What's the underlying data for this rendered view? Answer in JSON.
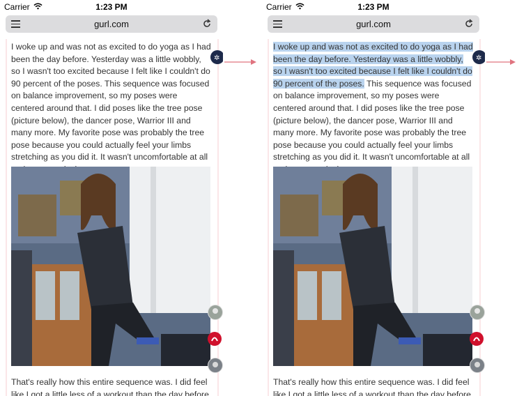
{
  "screens": [
    {
      "status": {
        "carrier": "Carrier",
        "time": "1:23 PM"
      },
      "browser": {
        "url": "gurl.com"
      },
      "article": {
        "paragraph1_highlighted": "",
        "paragraph1": "I woke up and was not as excited to do yoga as I had been the day before. Yesterday was a little wobbly, so I wasn't too excited because I felt like I couldn't do 90 percent of the poses. This sequence was focused on balance improvement, so my poses were centered around that. I did poses like the tree pose (picture below), the dancer pose, Warrior III and many more. My favorite pose was probably the tree pose because you could actually feel your limbs stretching as you did it. It wasn't uncomfortable at all and was so relaxing.",
        "paragraph2": "That's really how this entire sequence was. I did feel like I got a little less of a workout than the day before,"
      }
    },
    {
      "status": {
        "carrier": "Carrier",
        "time": "1:23 PM"
      },
      "browser": {
        "url": "gurl.com"
      },
      "article": {
        "paragraph1_highlighted": "I woke up and was not as excited to do yoga as I had been the day before. Yesterday was a little wobbly, so I wasn't too excited because I felt like I couldn't do 90 percent of the poses.",
        "paragraph1": " This sequence was focused on balance improvement, so my poses were centered around that. I did poses like the tree pose (picture below), the dancer pose, Warrior III and many more. My favorite pose was probably the tree pose because you could actually feel your limbs stretching as you did it. It wasn't uncomfortable at all and was so relaxing.",
        "paragraph2": "That's really how this entire sequence was. I did feel like I got a little less of a workout than the day before,"
      }
    }
  ],
  "colors": {
    "highlight": "#b9d3ee",
    "arrow": "#e0737f",
    "urlbar": "#dcdcde"
  },
  "icons": [
    "wifi-icon",
    "menu-icon",
    "reload-icon",
    "side-badge-icon",
    "lululemon-icon",
    "arrow-right-icon"
  ]
}
